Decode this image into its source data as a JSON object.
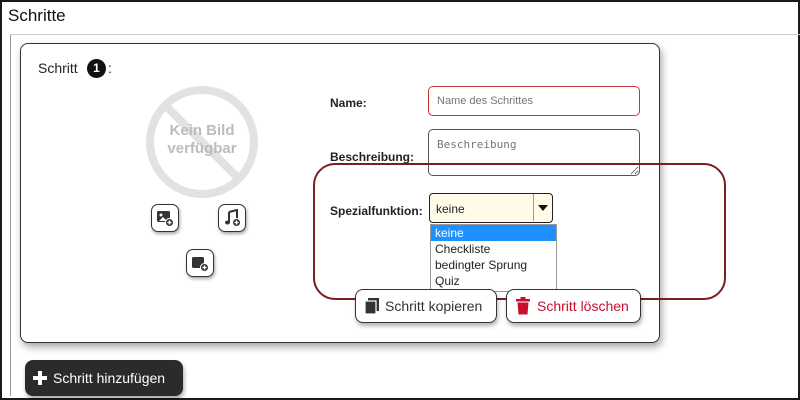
{
  "section": {
    "title": "Schritte"
  },
  "step": {
    "label": "Schritt",
    "number": "1",
    "colon": ":"
  },
  "image_placeholder": {
    "line1": "Kein Bild",
    "line2": "verfügbar"
  },
  "form": {
    "name_label": "Name:",
    "name_placeholder": "Name des Schrittes",
    "description_label": "Beschreibung:",
    "description_placeholder": "Beschreibung",
    "special_label": "Spezialfunktion:",
    "special_value": "keine",
    "special_options": [
      "keine",
      "Checkliste",
      "bedingter Sprung",
      "Quiz"
    ]
  },
  "buttons": {
    "copy": "Schritt kopieren",
    "delete": "Schritt löschen",
    "add": "Schritt hinzufügen"
  },
  "icons": {
    "add_image": "add-image-icon",
    "add_audio": "add-audio-icon",
    "add_video": "add-video-icon",
    "copy": "copy-icon",
    "delete": "trash-icon",
    "add": "plus-icon",
    "dropdown": "caret-down-icon"
  },
  "colors": {
    "highlight": "#7a1f1f",
    "delete": "#c8102e",
    "selected_option": "#1e90ff",
    "select_bg": "#fffbe8",
    "input_border": "#cc3333"
  }
}
